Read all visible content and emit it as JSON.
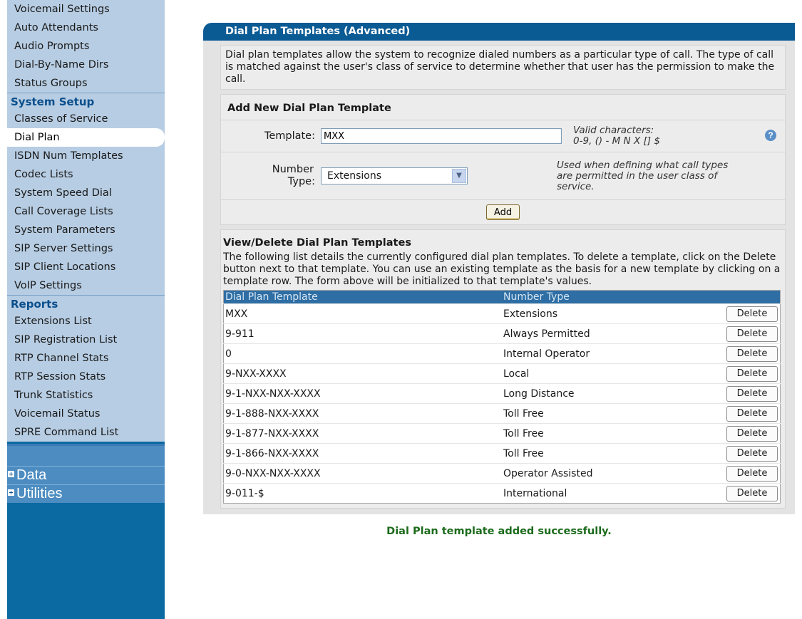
{
  "sidebar": {
    "top_items": [
      "Voicemail Settings",
      "Auto Attendants",
      "Audio Prompts",
      "Dial-By-Name Dirs",
      "Status Groups"
    ],
    "system_setup": {
      "heading": "System Setup",
      "items": [
        "Classes of Service",
        "Dial Plan",
        "ISDN Num Templates",
        "Codec Lists",
        "System Speed Dial",
        "Call Coverage Lists",
        "System Parameters",
        "SIP Server Settings",
        "SIP Client Locations",
        "VoIP Settings"
      ],
      "active": "Dial Plan"
    },
    "reports": {
      "heading": "Reports",
      "items": [
        "Extensions List",
        "SIP Registration List",
        "RTP Channel Stats",
        "RTP Session Stats",
        "Trunk Statistics",
        "Voicemail Status",
        "SPRE Command List"
      ]
    },
    "groups": [
      "Data",
      "Utilities"
    ]
  },
  "page": {
    "title": "Dial Plan Templates (Advanced)",
    "intro": "Dial plan templates allow the system to recognize dialed numbers as a particular type of call. The type of call is matched against the user's class of service to determine whether that user has the permission to make the call."
  },
  "add_form": {
    "heading": "Add New Dial Plan Template",
    "template_label": "Template:",
    "template_value": "MXX",
    "template_hint_line1": "Valid characters:",
    "template_hint_line2": "0-9, () - M N X [] $",
    "help_icon": "?",
    "number_type_label_line1": "Number",
    "number_type_label_line2": "Type:",
    "number_type_value": "Extensions",
    "number_type_hint": "Used when defining what call types are permitted in the user class of service.",
    "add_label": "Add"
  },
  "view": {
    "heading": "View/Delete Dial Plan Templates",
    "description": "The following list details the currently configured dial plan templates. To delete a template, click on the Delete button next to that template. You can use an existing template as the basis for a new template by clicking on a template row. The form above will be initialized to that template's values.",
    "columns": [
      "Dial Plan Template",
      "Number Type"
    ],
    "delete_label": "Delete",
    "rows": [
      {
        "template": "MXX",
        "type": "Extensions"
      },
      {
        "template": "9-911",
        "type": "Always Permitted"
      },
      {
        "template": "0",
        "type": "Internal Operator"
      },
      {
        "template": "9-NXX-XXXX",
        "type": "Local"
      },
      {
        "template": "9-1-NXX-NXX-XXXX",
        "type": "Long Distance"
      },
      {
        "template": "9-1-888-NXX-XXXX",
        "type": "Toll Free"
      },
      {
        "template": "9-1-877-NXX-XXXX",
        "type": "Toll Free"
      },
      {
        "template": "9-1-866-NXX-XXXX",
        "type": "Toll Free"
      },
      {
        "template": "9-0-NXX-NXX-XXXX",
        "type": "Operator Assisted"
      },
      {
        "template": "9-011-$",
        "type": "International"
      }
    ]
  },
  "status_message": "Dial Plan template added successfully.",
  "colors": {
    "sidebar_bg": "#b7cde3",
    "sidebar_dark": "#0a6aa1",
    "title_bar": "#0a5a94",
    "table_header": "#2e6ea4",
    "success": "#1c6b1c"
  }
}
